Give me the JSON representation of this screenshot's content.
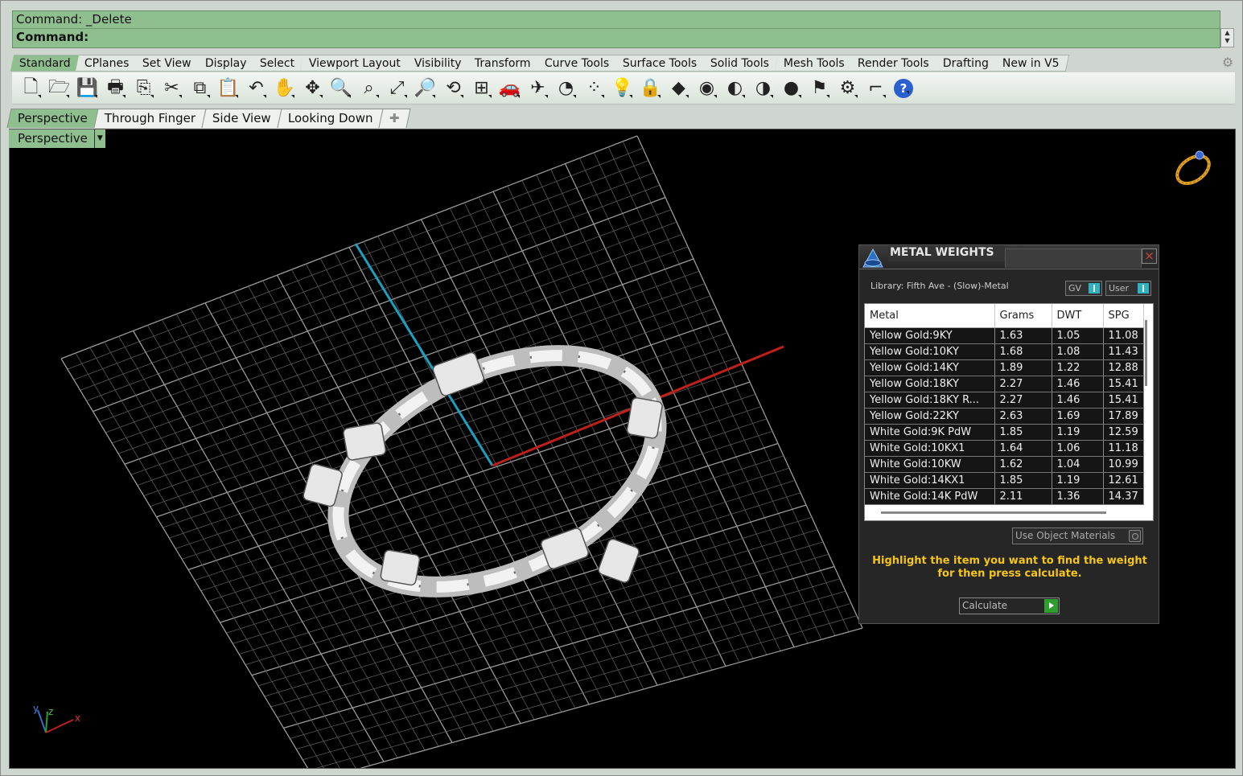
{
  "command": {
    "history_line": "Command: _Delete",
    "prompt_line": "Command:"
  },
  "toolbar_tabs": [
    "Standard",
    "CPlanes",
    "Set View",
    "Display",
    "Select",
    "Viewport Layout",
    "Visibility",
    "Transform",
    "Curve Tools",
    "Surface Tools",
    "Solid Tools",
    "Mesh Tools",
    "Render Tools",
    "Drafting",
    "New in V5"
  ],
  "toolbar_icons": [
    "new-file-icon",
    "open-folder-icon",
    "save-icon",
    "print-icon",
    "import-icon",
    "cut-icon",
    "copy-icon",
    "paste-icon",
    "undo-icon",
    "pan-hand-icon",
    "move-icon",
    "zoom-icon",
    "zoom-window-icon",
    "zoom-extents-icon",
    "zoom-selected-icon",
    "rotate-view-icon",
    "four-viewports-icon",
    "car-icon",
    "plane-icon",
    "circle-icon",
    "points-icon",
    "light-bulb-icon",
    "lock-icon",
    "render-material-icon",
    "color-wheel-icon",
    "shaded-sphere-icon",
    "rendered-sphere-icon",
    "blue-sphere-icon",
    "render-light-icon",
    "gear-settings-icon",
    "dimension-icon",
    "help-icon"
  ],
  "viewport_tabs": [
    "Perspective",
    "Through Finger",
    "Side View",
    "Looking Down"
  ],
  "viewport": {
    "label": "Perspective",
    "axis": {
      "x": "x",
      "y": "y",
      "z": "z"
    }
  },
  "metal_weights": {
    "title": "METAL WEIGHTS",
    "library": "Library: Fifth Ave - (Slow)-Metal",
    "toggle_gv": "GV",
    "toggle_user": "User",
    "columns": [
      "Metal",
      "Grams",
      "DWT",
      "SPG"
    ],
    "rows": [
      [
        "Yellow Gold:9KY",
        "1.63",
        "1.05",
        "11.08"
      ],
      [
        "Yellow Gold:10KY",
        "1.68",
        "1.08",
        "11.43"
      ],
      [
        "Yellow Gold:14KY",
        "1.89",
        "1.22",
        "12.88"
      ],
      [
        "Yellow Gold:18KY",
        "2.27",
        "1.46",
        "15.41"
      ],
      [
        "Yellow Gold:18KY R...",
        "2.27",
        "1.46",
        "15.41"
      ],
      [
        "Yellow Gold:22KY",
        "2.63",
        "1.69",
        "17.89"
      ],
      [
        "White Gold:9K PdW",
        "1.85",
        "1.19",
        "12.59"
      ],
      [
        "White Gold:10KX1",
        "1.64",
        "1.06",
        "11.18"
      ],
      [
        "White Gold:10KW",
        "1.62",
        "1.04",
        "10.99"
      ],
      [
        "White Gold:14KX1",
        "1.85",
        "1.19",
        "12.61"
      ],
      [
        "White Gold:14K PdW",
        "2.11",
        "1.36",
        "14.37"
      ]
    ],
    "use_object_materials": "Use Object Materials",
    "help_text": "Highlight the item you want to find the weight for then press calculate.",
    "calculate": "Calculate"
  },
  "colors": {
    "accent_green": "#8fbe8f",
    "x_axis": "#c0201a",
    "y_axis": "#1aa0c0",
    "help_text": "#f5c518"
  }
}
